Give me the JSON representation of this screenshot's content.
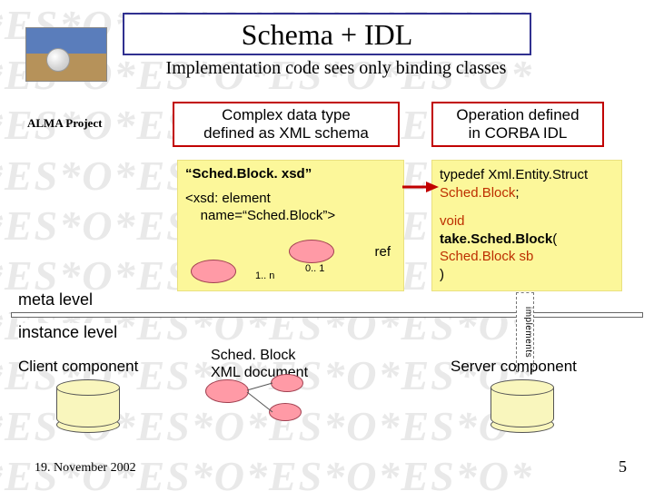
{
  "title": "Schema + IDL",
  "subtitle": "Implementation code sees only binding classes",
  "alma_label": "ALMA Project",
  "box_xml_l1": "Complex data type",
  "box_xml_l2": "defined as XML schema",
  "box_idl_l1": "Operation defined",
  "box_idl_l2": "in CORBA IDL",
  "xsd_file": "“Sched.Block. xsd”",
  "xsd_line1": "<xsd: element",
  "xsd_line2": "    name=“Sched.Block”>",
  "xsd_ref": "ref",
  "xsd_card01": "0.. 1",
  "xsd_card1n": "1.. n",
  "idl_typedef1": "typedef Xml.Entity.Struct",
  "idl_typedef2": "Sched.Block",
  "idl_semi": ";",
  "idl_void": "void",
  "idl_take": "take.Sched.Block",
  "idl_open": "(",
  "idl_arg": "Sched.Block sb",
  "idl_close": ")",
  "meta": "meta level",
  "instance": "instance level",
  "client": "Client component",
  "server": "Server component",
  "xml_doc_l1": "Sched. Block",
  "xml_doc_l2": "XML document",
  "implements": "implements",
  "footer_date": "19. November 2002",
  "footer_page": "5",
  "wm": "*ES*O*ES*O*ES*O*ES*O*"
}
